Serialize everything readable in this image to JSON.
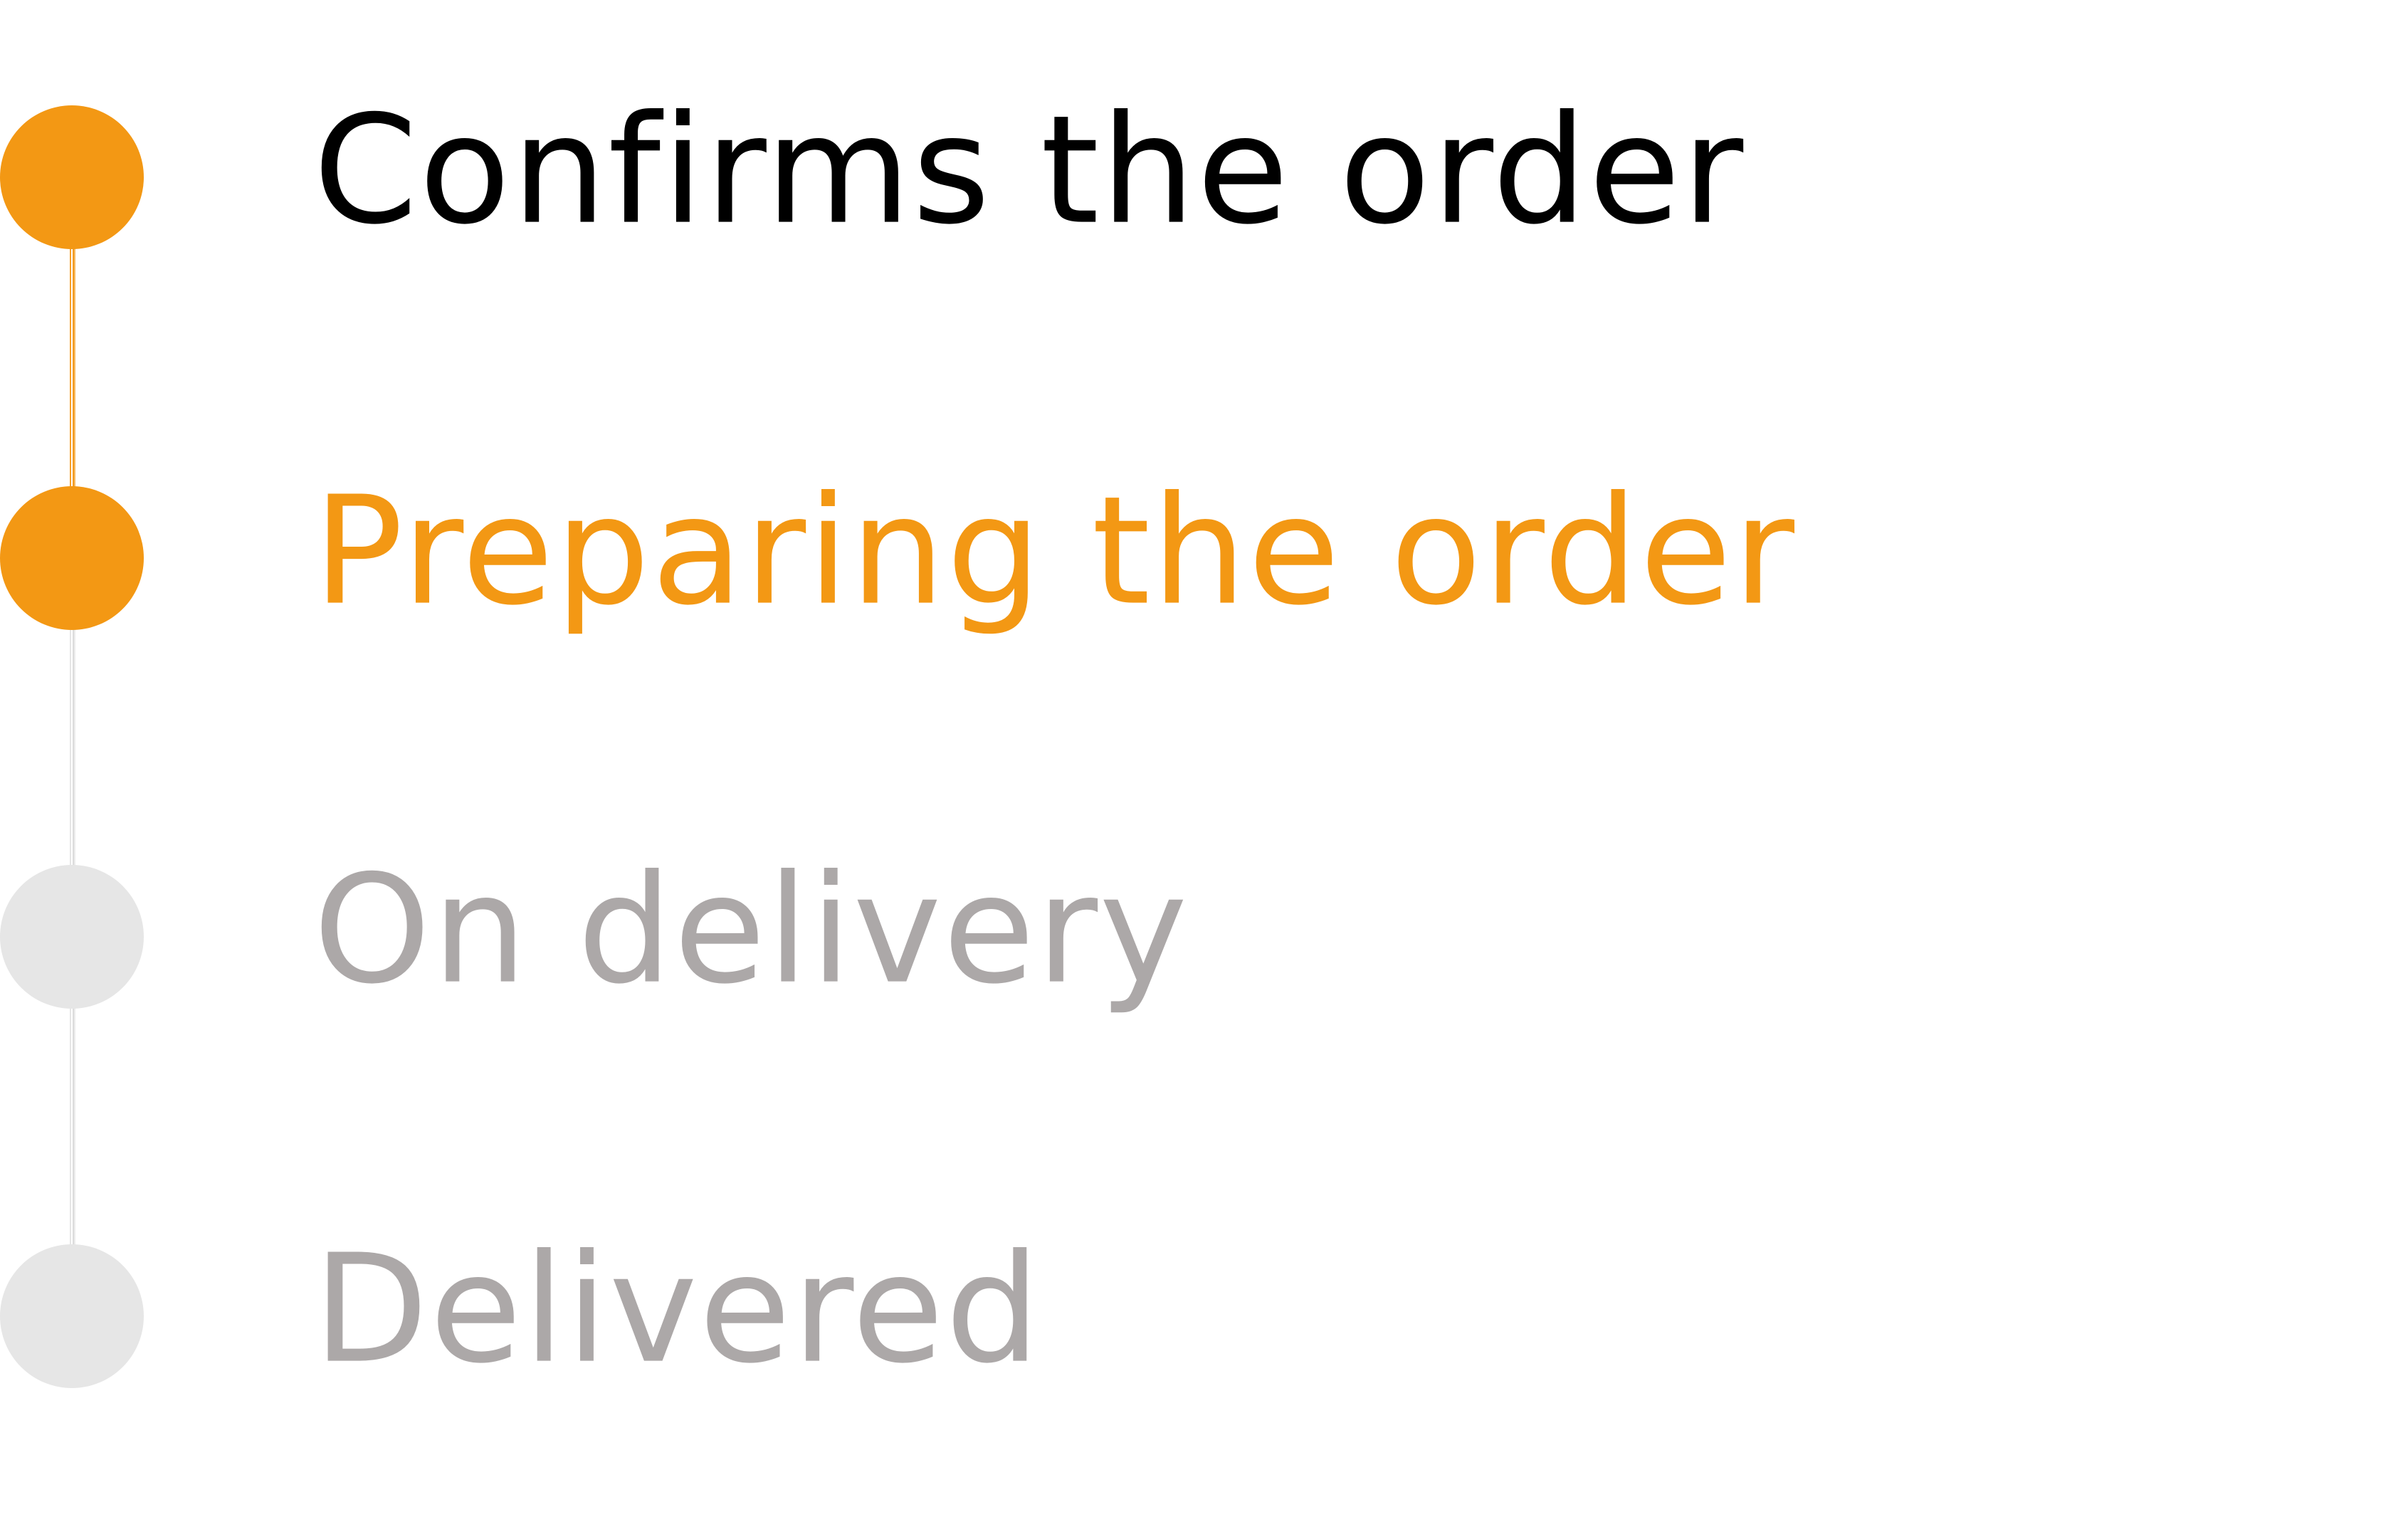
{
  "colors": {
    "active": "#f39814",
    "pending_dot": "#e6e6e6",
    "completed_text": "#000000",
    "pending_text": "#aca8a8"
  },
  "steps": [
    {
      "label": "Confirms the order",
      "status": "completed"
    },
    {
      "label": "Preparing the order",
      "status": "current"
    },
    {
      "label": "On delivery",
      "status": "pending"
    },
    {
      "label": "Delivered",
      "status": "pending"
    }
  ]
}
